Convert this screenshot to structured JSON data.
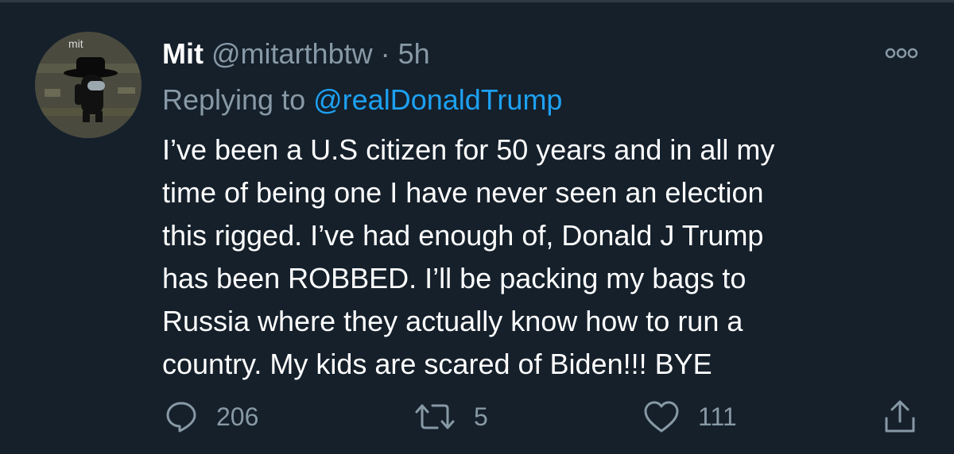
{
  "tweet": {
    "display_name": "Mit",
    "handle": "@mitarthbtw",
    "separator": "·",
    "time": "5h",
    "reply_prefix": "Replying to",
    "reply_to": "@realDonaldTrump",
    "avatar_label": "mit",
    "text_lines": [
      "I’ve been a U.S citizen for 50 years and in all my",
      "time of being one I have never seen an election",
      "this rigged. I’ve had enough of, Donald J Trump",
      "has been ROBBED. I’ll be packing my bags to",
      "Russia where they actually know how to run a",
      "country. My kids are scared of Biden!!! BYE"
    ]
  },
  "actions": {
    "reply_count": "206",
    "retweet_count": "5",
    "like_count": "111"
  },
  "icons": {
    "reply": "reply-icon",
    "retweet": "retweet-icon",
    "like": "heart-icon",
    "share": "share-icon",
    "more": "more-icon"
  },
  "colors": {
    "background": "#15202b",
    "secondary_text": "#8899a6",
    "link": "#1da1f2"
  }
}
